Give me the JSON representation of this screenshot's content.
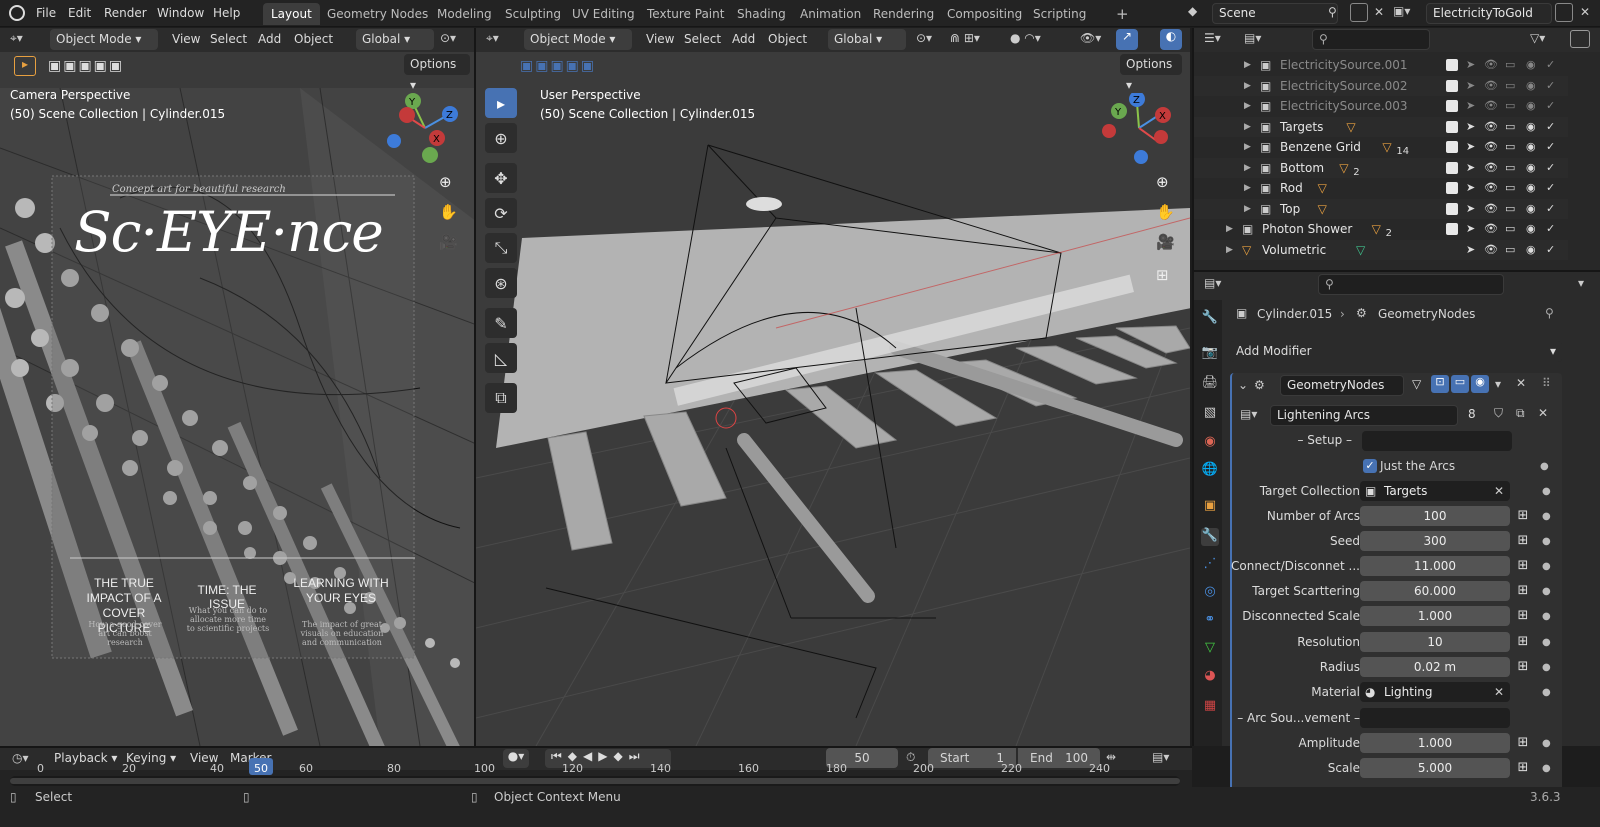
{
  "topbar": {
    "menus": [
      "File",
      "Edit",
      "Render",
      "Window",
      "Help"
    ],
    "workspaces": [
      "Layout",
      "Geometry Nodes",
      "Modeling",
      "Sculpting",
      "UV Editing",
      "Texture Paint",
      "Shading",
      "Animation",
      "Rendering",
      "Compositing",
      "Scripting"
    ],
    "active_workspace": "Layout",
    "add_tab": "+",
    "scene": "Scene",
    "view_layer": "ElectricityToGold"
  },
  "left_vp": {
    "mode": "Object Mode",
    "menus": [
      "View",
      "Select",
      "Add",
      "Object"
    ],
    "orientation": "Global",
    "options": "Options",
    "perspective": "Camera Perspective",
    "info": "(50) Scene Collection | Cylinder.015"
  },
  "poster": {
    "tagline": "Concept art for beautiful research",
    "title": "Sc·EYE·nce",
    "col1_title": "THE TRUE IMPACT OF A COVER PICTURE",
    "col1_body": "How a good cover art can boost research",
    "col2_title": "TIME: THE ISSUE",
    "col2_body": "What you can do to allocate more time to scientific projects",
    "col3_title": "LEARNING WITH YOUR EYES",
    "col3_body": "The impact of great visuals on education and communication"
  },
  "right_vp": {
    "mode": "Object Mode",
    "menus": [
      "View",
      "Select",
      "Add",
      "Object"
    ],
    "orientation": "Global",
    "options": "Options",
    "perspective": "User Perspective",
    "info": "(50) Scene Collection | Cylinder.015"
  },
  "gizmo": {
    "x": "X",
    "y": "Y",
    "z": "Z"
  },
  "outliner": {
    "search_placeholder": "",
    "rows": [
      {
        "name": "ElectricitySource.001",
        "dim": true,
        "extra": ""
      },
      {
        "name": "ElectricitySource.002",
        "dim": true,
        "extra": ""
      },
      {
        "name": "ElectricitySource.003",
        "dim": true,
        "extra": ""
      },
      {
        "name": "Targets",
        "dim": false,
        "extra": ""
      },
      {
        "name": "Benzene Grid",
        "dim": false,
        "extra": "14"
      },
      {
        "name": "Bottom",
        "dim": false,
        "extra": "2"
      },
      {
        "name": "Rod",
        "dim": false,
        "extra": ""
      },
      {
        "name": "Top",
        "dim": false,
        "extra": ""
      },
      {
        "name": "Photon Shower",
        "dim": false,
        "extra": "2"
      },
      {
        "name": "Volumetric",
        "dim": false,
        "extra": ""
      }
    ]
  },
  "properties": {
    "object": "Cylinder.015",
    "modifier_crumb": "GeometryNodes",
    "add_modifier": "Add Modifier",
    "modifier_name": "GeometryNodes",
    "node_group": "Lightening Arcs",
    "users": "8",
    "setup_label": "– Setup –",
    "just_arcs": "Just the Arcs",
    "fields": [
      {
        "label": "Target Collection",
        "value": "Targets",
        "kind": "collection"
      },
      {
        "label": "Number of Arcs",
        "value": "100",
        "kind": "num"
      },
      {
        "label": "Seed",
        "value": "300",
        "kind": "num"
      },
      {
        "label": "Connect/Disconnet ...",
        "value": "11.000",
        "kind": "num"
      },
      {
        "label": "Target Scarttering",
        "value": "60.000",
        "kind": "num"
      },
      {
        "label": "Disconnected Scale",
        "value": "1.000",
        "kind": "num"
      },
      {
        "label": "Resolution",
        "value": "10",
        "kind": "num"
      },
      {
        "label": "Radius",
        "value": "0.02 m",
        "kind": "num"
      },
      {
        "label": "Material",
        "value": "Lighting",
        "kind": "material"
      },
      {
        "label": "– Arc Sou...vement –",
        "value": "",
        "kind": "empty"
      },
      {
        "label": "Amplitude",
        "value": "1.000",
        "kind": "num"
      },
      {
        "label": "Scale",
        "value": "5.000",
        "kind": "num"
      }
    ]
  },
  "timeline": {
    "menus": [
      "Playback",
      "Keying",
      "View",
      "Marker"
    ],
    "current_frame": "50",
    "start_label": "Start",
    "start": "1",
    "end_label": "End",
    "end": "100",
    "ticks": [
      "0",
      "20",
      "40",
      "50",
      "60",
      "80",
      "100",
      "120",
      "140",
      "160",
      "180",
      "200",
      "220",
      "240"
    ]
  },
  "statusbar": {
    "left": "Select",
    "middle": "Object Context Menu",
    "version": "3.6.3"
  },
  "colors": {
    "accent": "#4772b3",
    "frame_marker": "#4772b3",
    "orange": "#e8a040",
    "active_tab": "#3d3d3d"
  }
}
